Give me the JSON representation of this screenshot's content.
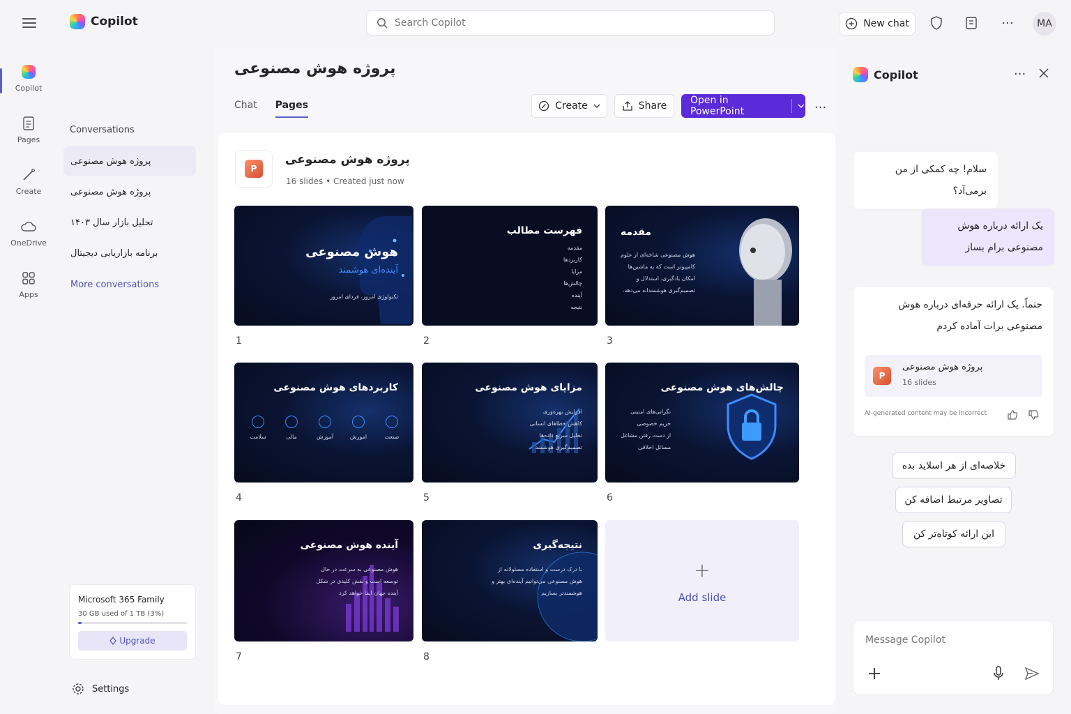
{
  "app": {
    "name": "Copilot",
    "avatar_initials": "MA"
  },
  "topbar": {
    "search_placeholder": "Search Copilot",
    "new_chat": "New chat"
  },
  "rail": [
    {
      "label": "Copilot",
      "icon": "copilot-icon"
    },
    {
      "label": "Pages",
      "icon": "pages-icon"
    },
    {
      "label": "Create",
      "icon": "create-icon"
    },
    {
      "label": "OneDrive",
      "icon": "cloud-icon"
    },
    {
      "label": "Apps",
      "icon": "apps-icon"
    }
  ],
  "sidebar": {
    "heading": "Conversations",
    "items": [
      "پروژه هوش مصنوعی",
      "پروژه هوش مصنوعی",
      "تحلیل بازار سال ۱۴۰۳",
      "برنامه بازاریابی دیجیتال"
    ],
    "more": "More conversations",
    "storage": {
      "title": "Microsoft 365 Family",
      "used": "30 GB used of 1 TB (3%)",
      "percent": 3,
      "upgrade": "Upgrade"
    },
    "settings": "Settings"
  },
  "main": {
    "title": "پروژه هوش مصنوعی",
    "tabs": [
      "Chat",
      "Pages"
    ],
    "active_tab": "Pages",
    "create": "Create",
    "share": "Share",
    "open_ppt": "Open in PowerPoint",
    "deck": {
      "title": "پروژه هوش مصنوعی",
      "meta": "16 slides • Created just now"
    },
    "slides": [
      {
        "num": "1",
        "title": "هوش مصنوعی",
        "subtitle": "آینده‌ای هوشمند",
        "lines": [
          "تکنولوژی امروز، فردای امروز"
        ]
      },
      {
        "num": "2",
        "title": "فهرست مطالب",
        "lines": [
          "مقدمه",
          "کاربردها",
          "مزایا",
          "چالش‌ها",
          "آینده",
          "نتیجه"
        ]
      },
      {
        "num": "3",
        "title": "مقدمه",
        "lines": [
          "هوش مصنوعی شاخه‌ای از علوم",
          "کامپیوتر است که به ماشین‌ها",
          "امکان یادگیری، استدلال و",
          "تصمیم‌گیری هوشمندانه می‌دهد."
        ]
      },
      {
        "num": "4",
        "title": "کاربردهای هوش مصنوعی",
        "icons": [
          "سلامت",
          "مالی",
          "آموزش",
          "امورش",
          "صنعت"
        ]
      },
      {
        "num": "5",
        "title": "مزایای هوش مصنوعی",
        "lines": [
          "افزایش بهره‌وری",
          "کاهش خطاهای انسانی",
          "تحلیل سریع داده‌ها",
          "تصمیم‌گیری هوشمند"
        ]
      },
      {
        "num": "6",
        "title": "چالش‌های هوش مصنوعی",
        "lines": [
          "نگرانی‌های امنیتی",
          "حریم خصوصی",
          "از دست رفتن مشاغل",
          "مسائل اخلاقی"
        ]
      },
      {
        "num": "7",
        "title": "آینده هوش مصنوعی",
        "lines": [
          "هوش مصنوعی به سرعت در حال",
          "توسعه است و نقش کلیدی در شکل",
          "آینده جهان ایفا خواهد کرد"
        ]
      },
      {
        "num": "8",
        "title": "نتیجه‌گیری",
        "lines": [
          "با درک درست و استفاده مسئولانه از",
          "هوش مصنوعی می‌توانیم آینده‌ای بهتر و",
          "هوشمندتر بسازیم"
        ]
      }
    ],
    "add_slide": "Add slide"
  },
  "panel": {
    "title": "Copilot",
    "assistant_greeting": "سلام! چه کمکی از من برمی‌آد؟",
    "user_message": "یک ارائه درباره هوش مصنوعی برام بساز",
    "assistant_reply": "حتماً. یک ارائه حرفه‌ای درباره هوش مصنوعی برات آماده کردم",
    "ref_card": {
      "title": "پروژه هوش مصنوعی",
      "meta": "16 slides"
    },
    "disclaimer": "AI-generated content may be incorrect",
    "suggestions": [
      "خلاصه‌ای از هر اسلاید بده",
      "تصاویر مرتبط اضافه کن",
      "این ارائه کوتاه‌تر کن"
    ],
    "composer_placeholder": "Message Copilot"
  },
  "colors": {
    "accent": "#5b2bd9",
    "link": "#4f52b2",
    "slide_bg": "#070b1e"
  }
}
